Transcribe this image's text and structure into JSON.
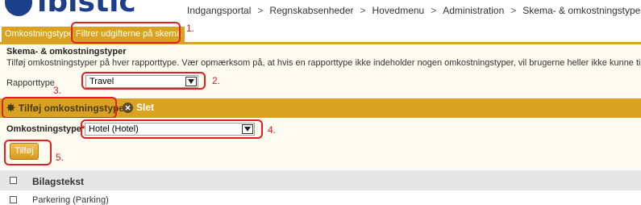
{
  "logo": {
    "text": "ibistic"
  },
  "breadcrumb": {
    "items": [
      "Indgangsportal",
      "Regnskabsenheder",
      "Hovedmenu",
      "Administration",
      "Skema- & omkostningstyper"
    ],
    "separator": ">"
  },
  "tabs": [
    {
      "label": "Omkostningstyper"
    },
    {
      "label": "Filtrer udgifterne på skema"
    }
  ],
  "section": {
    "title": "Skema- & omkostningstyper",
    "description": "Tilføj omkostningstyper på hver rapporttype. Vær opmærksom på, at hvis en rapporttype ikke indeholder nogen omkostningstyper, vil brugerne heller ikke kunne tilføje udla"
  },
  "report_type": {
    "label": "Rapporttype",
    "value": "Travel"
  },
  "toolbar": {
    "add_label": "Tilføj omkostningstype",
    "delete_label": "Slet"
  },
  "cost_type": {
    "label": "Omkostningstype",
    "required_mark": "*",
    "value": "Hotel (Hotel)"
  },
  "add_button": {
    "label": "Tilføj"
  },
  "table": {
    "header": "Bilagstekst",
    "rows": [
      {
        "label": "Parkering (Parking)"
      }
    ]
  },
  "annotations": [
    "1.",
    "2.",
    "3.",
    "4.",
    "5."
  ],
  "colors": {
    "accent": "#d9a321",
    "annotation": "#e02020",
    "brand": "#1d3f8a",
    "panel_bg": "#fffbf1"
  },
  "icons": {
    "add": "gear-star-icon",
    "delete": "close-circle-icon",
    "dropdown": "chevron-down-icon"
  }
}
